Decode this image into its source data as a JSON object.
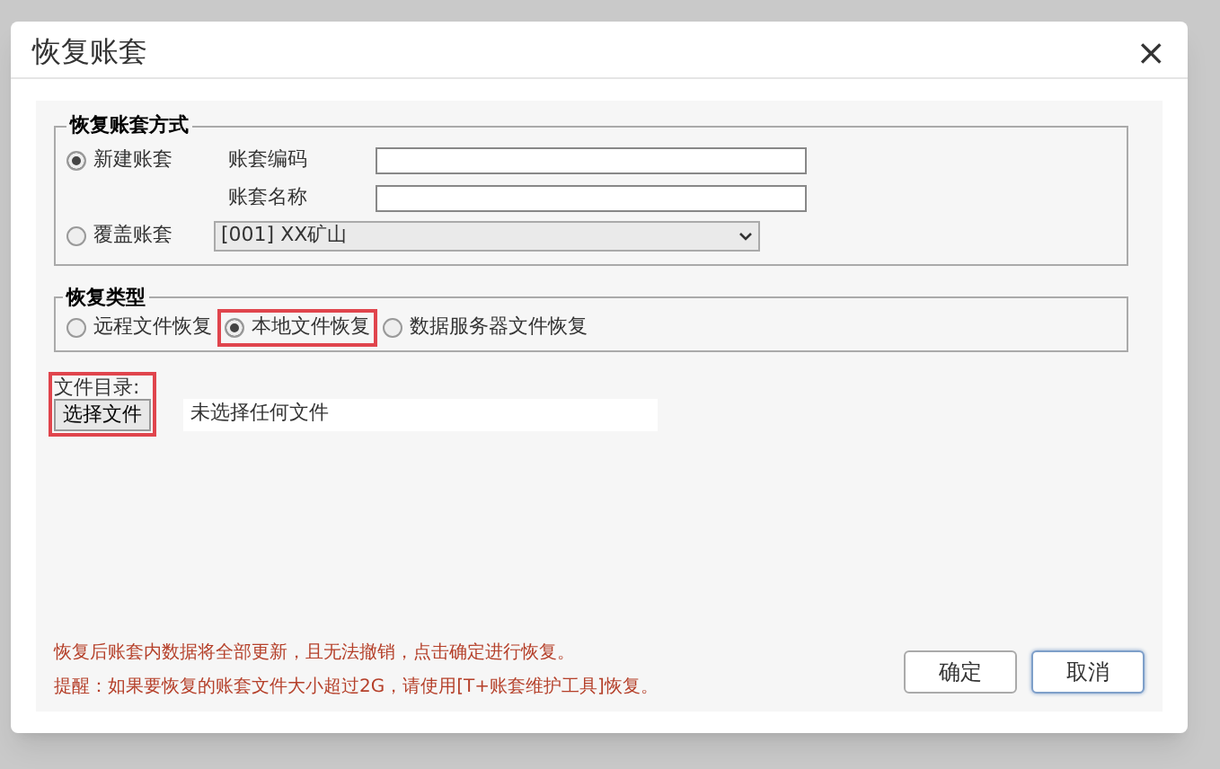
{
  "window": {
    "title": "恢复账套",
    "close": "×"
  },
  "restore_method": {
    "legend": "恢复账套方式",
    "options": [
      {
        "label": "新建账套",
        "selected": true
      },
      {
        "label": "覆盖账套",
        "selected": false
      }
    ],
    "fields": [
      {
        "label": "账套编码"
      },
      {
        "label": "账套名称"
      }
    ],
    "account_dropdown": {
      "value": "[001] XX矿山"
    }
  },
  "restore_type": {
    "legend": "恢复类型",
    "options": [
      {
        "label": "远程文件恢复",
        "selected": false,
        "highlighted": false
      },
      {
        "label": "本地文件恢复",
        "selected": true,
        "highlighted": true
      },
      {
        "label": "数据服务器文件恢复",
        "selected": false,
        "highlighted": false
      }
    ]
  },
  "file": {
    "label": "文件目录:",
    "button": "选择文件",
    "status": "未选择任何文件",
    "highlighted": true
  },
  "notes": [
    "恢复后账套内数据将全部更新，且无法撤销，点击确定进行恢复。",
    "提醒：如果要恢复的账套文件大小超过2G，请使用[T+账套维护工具]恢复。"
  ],
  "buttons": [
    {
      "label": "确定",
      "primary": false
    },
    {
      "label": "取消",
      "primary": true
    }
  ]
}
